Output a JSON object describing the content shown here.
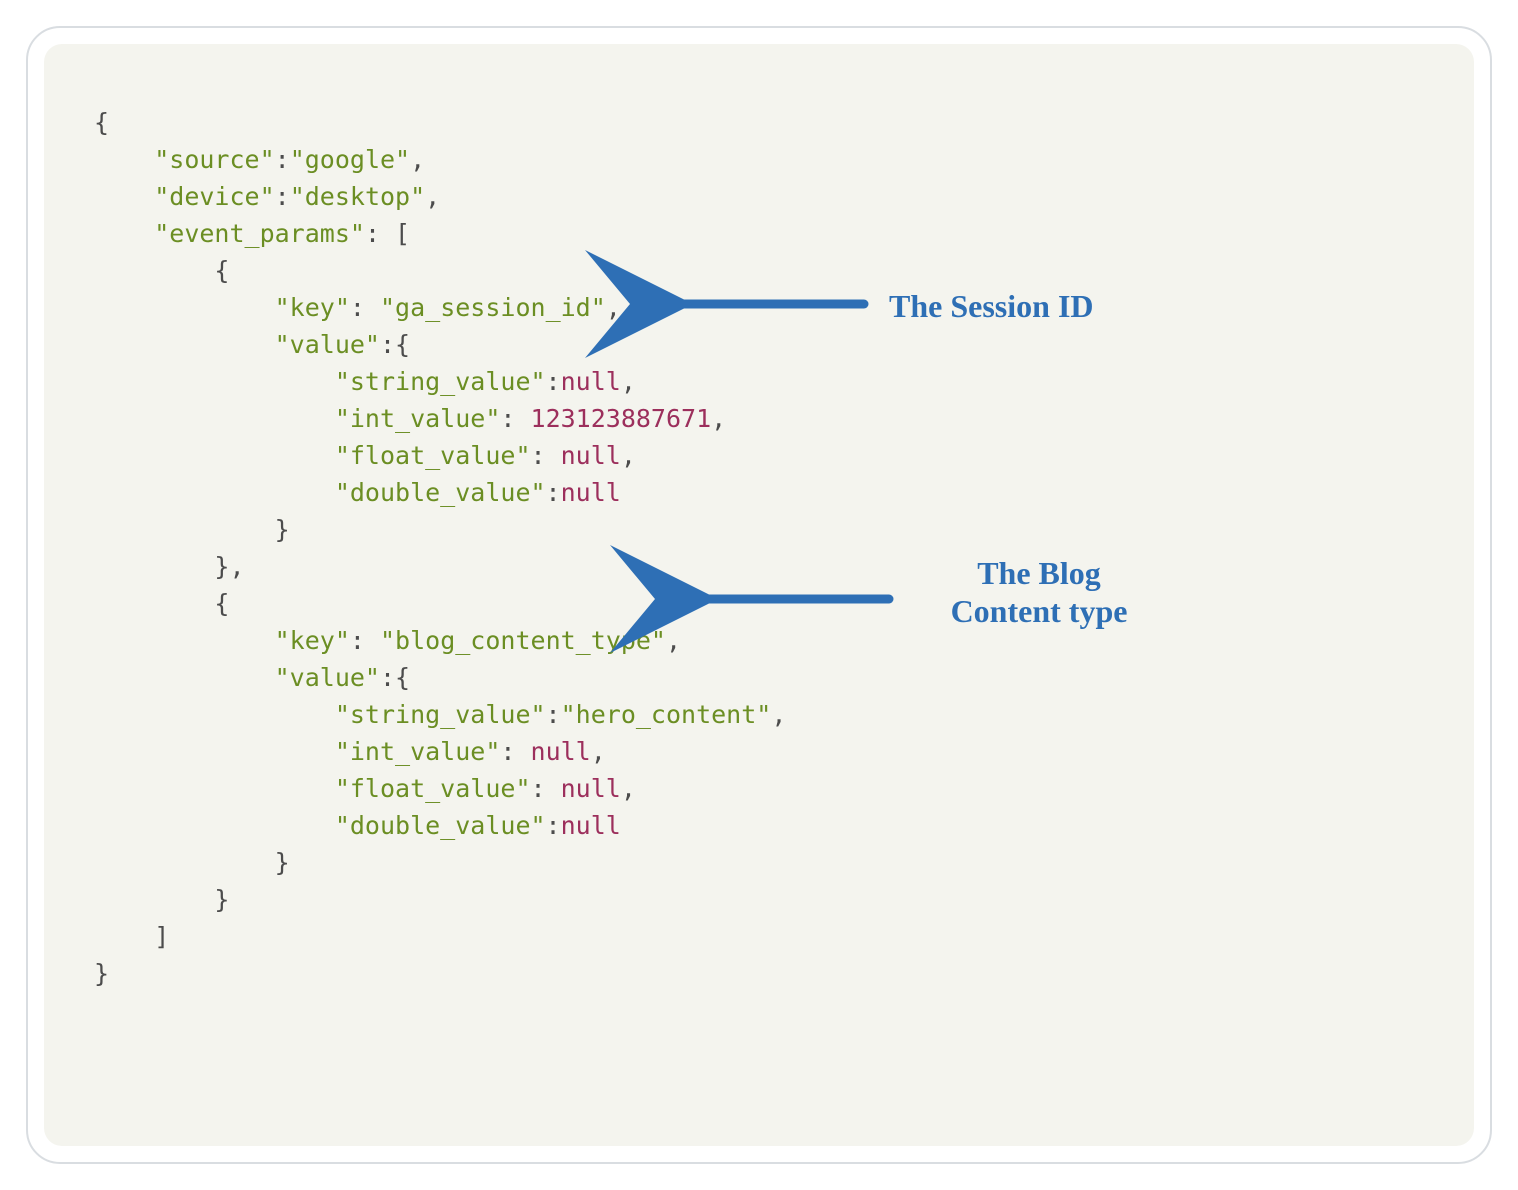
{
  "code": {
    "line1": "{",
    "line2a": "    ",
    "line2k": "\"source\"",
    "line2c": ":",
    "line2v": "\"google\"",
    "line2e": ",",
    "line3a": "    ",
    "line3k": "\"device\"",
    "line3c": ":",
    "line3v": "\"desktop\"",
    "line3e": ",",
    "line4a": "    ",
    "line4k": "\"event_params\"",
    "line4c": ": [",
    "line5": "        {",
    "line6a": "            ",
    "line6k": "\"key\"",
    "line6c": ": ",
    "line6v": "\"ga_session_id\"",
    "line6e": ",",
    "line7a": "            ",
    "line7k": "\"value\"",
    "line7c": ":{",
    "line8a": "                ",
    "line8k": "\"string_value\"",
    "line8c": ":",
    "line8v": "null",
    "line8e": ",",
    "line9a": "                ",
    "line9k": "\"int_value\"",
    "line9c": ": ",
    "line9v": "123123887671",
    "line9e": ",",
    "line10a": "                ",
    "line10k": "\"float_value\"",
    "line10c": ": ",
    "line10v": "null",
    "line10e": ",",
    "line11a": "                ",
    "line11k": "\"double_value\"",
    "line11c": ":",
    "line11v": "null",
    "line12": "            }",
    "line13": "        },",
    "line14": "        {",
    "line15a": "            ",
    "line15k": "\"key\"",
    "line15c": ": ",
    "line15v": "\"blog_content_type\"",
    "line15e": ",",
    "line16a": "            ",
    "line16k": "\"value\"",
    "line16c": ":{",
    "line17a": "                ",
    "line17k": "\"string_value\"",
    "line17c": ":",
    "line17v": "\"hero_content\"",
    "line17e": ",",
    "line18a": "                ",
    "line18k": "\"int_value\"",
    "line18c": ": ",
    "line18v": "null",
    "line18e": ",",
    "line19a": "                ",
    "line19k": "\"float_value\"",
    "line19c": ": ",
    "line19v": "null",
    "line19e": ",",
    "line20a": "                ",
    "line20k": "\"double_value\"",
    "line20c": ":",
    "line20v": "null",
    "line21": "            }",
    "line22": "        }",
    "line23": "    ]",
    "line24": "}"
  },
  "annotations": {
    "session": "The Session ID",
    "blog1": "The Blog",
    "blog2": "Content type"
  },
  "colors": {
    "arrow": "#2e6fb5"
  }
}
